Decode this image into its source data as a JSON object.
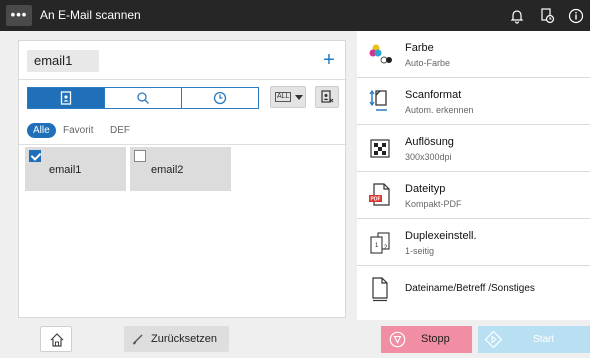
{
  "header": {
    "menu_label": "•••",
    "title": "An E-Mail scannen"
  },
  "destination": {
    "value": "email1",
    "add_label": "+"
  },
  "filters": {
    "all": "Alle",
    "favorite": "Favorit",
    "def": "DEF"
  },
  "dropdown": {
    "label": "ALL"
  },
  "addresses": [
    {
      "label": "email1",
      "checked": true
    },
    {
      "label": "email2",
      "checked": false
    }
  ],
  "settings": [
    {
      "title": "Farbe",
      "value": "Auto-Farbe"
    },
    {
      "title": "Scanformat",
      "value": "Autom. erkennen"
    },
    {
      "title": "Auflösung",
      "value": "300x300dpi"
    },
    {
      "title": "Dateityp",
      "value": "Kompakt-PDF"
    },
    {
      "title": "Duplexeinstell.",
      "value": "1-seitig"
    },
    {
      "title": "Dateiname/Betreff /Sonstiges"
    }
  ],
  "pdf_badge": "PDF",
  "footer": {
    "reset": "Zurücksetzen",
    "stop": "Stopp",
    "start": "Start"
  },
  "colors": {
    "accent": "#1f70b8",
    "stop": "#f28ea3",
    "start": "#b9dff2",
    "topbar": "#262626"
  }
}
